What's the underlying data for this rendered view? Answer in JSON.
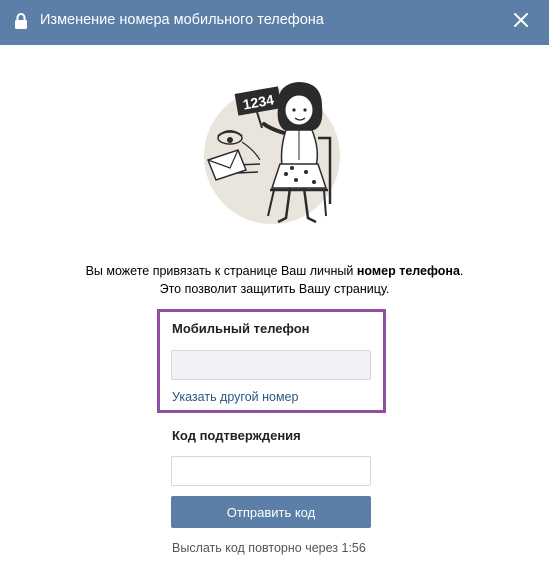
{
  "header": {
    "title": "Изменение номера мобильного телефона",
    "lock_icon": "lock-icon",
    "close_icon": "close-icon"
  },
  "illustration": {
    "name": "woman-with-phone-number-sign-illustration",
    "sign_text": "1234"
  },
  "description": {
    "line1_prefix": "Вы можете привязать к странице Ваш личный ",
    "line1_bold": "номер телефона",
    "line1_suffix": ".",
    "line2": "Это позволит защитить Вашу страницу."
  },
  "phone": {
    "label": "Мобильный телефон",
    "value": "",
    "change_link": "Указать другой номер"
  },
  "code": {
    "label": "Код подтверждения",
    "value": "",
    "placeholder": ""
  },
  "send_button": "Отправить код",
  "resend_text": "Выслать код повторно через 1:56",
  "colors": {
    "header": "#5b7fa6",
    "button": "#5b7fa6",
    "link": "#2a5885",
    "highlight": "#8e4f9e",
    "illustration_bg": "#e9e4dc"
  }
}
